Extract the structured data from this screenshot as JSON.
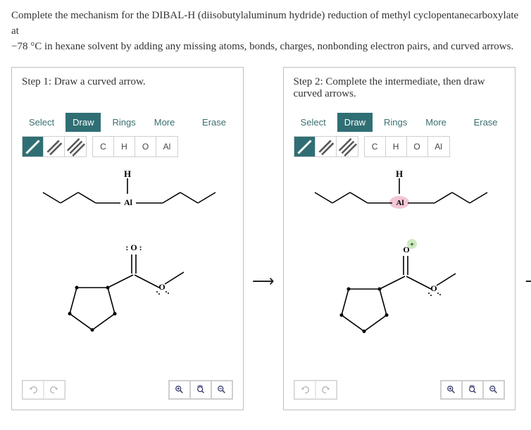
{
  "prompt": {
    "line1": "Complete the mechanism for the DIBAL-H (diisobutylaluminum hydride) reduction of methyl cyclopentanecarboxylate at",
    "line2": "−78 °C in hexane solvent by adding any missing atoms, bonds, charges, nonbonding electron pairs, and curved arrows."
  },
  "toolbar": {
    "select": "Select",
    "draw": "Draw",
    "rings": "Rings",
    "more": "More",
    "erase": "Erase"
  },
  "atoms": {
    "c": "C",
    "h": "H",
    "o": "O",
    "al": "Al"
  },
  "step1": {
    "title": "Step 1: Draw a curved arrow.",
    "labels": {
      "H": "H",
      "Al": "Al",
      "O_lone": ": O :"
    }
  },
  "step2": {
    "title": "Step 2: Complete the intermediate, then draw curved arrows.",
    "labels": {
      "H": "H",
      "Al": "Al",
      "O": "O",
      "plus": "+"
    }
  },
  "icons": {
    "single_bond": "single-bond",
    "double_bond": "double-bond",
    "triple_bond": "triple-bond",
    "undo": "undo",
    "redo": "redo",
    "zoom_in": "zoom-in",
    "zoom_reset": "zoom-reset",
    "zoom_out": "zoom-out"
  }
}
